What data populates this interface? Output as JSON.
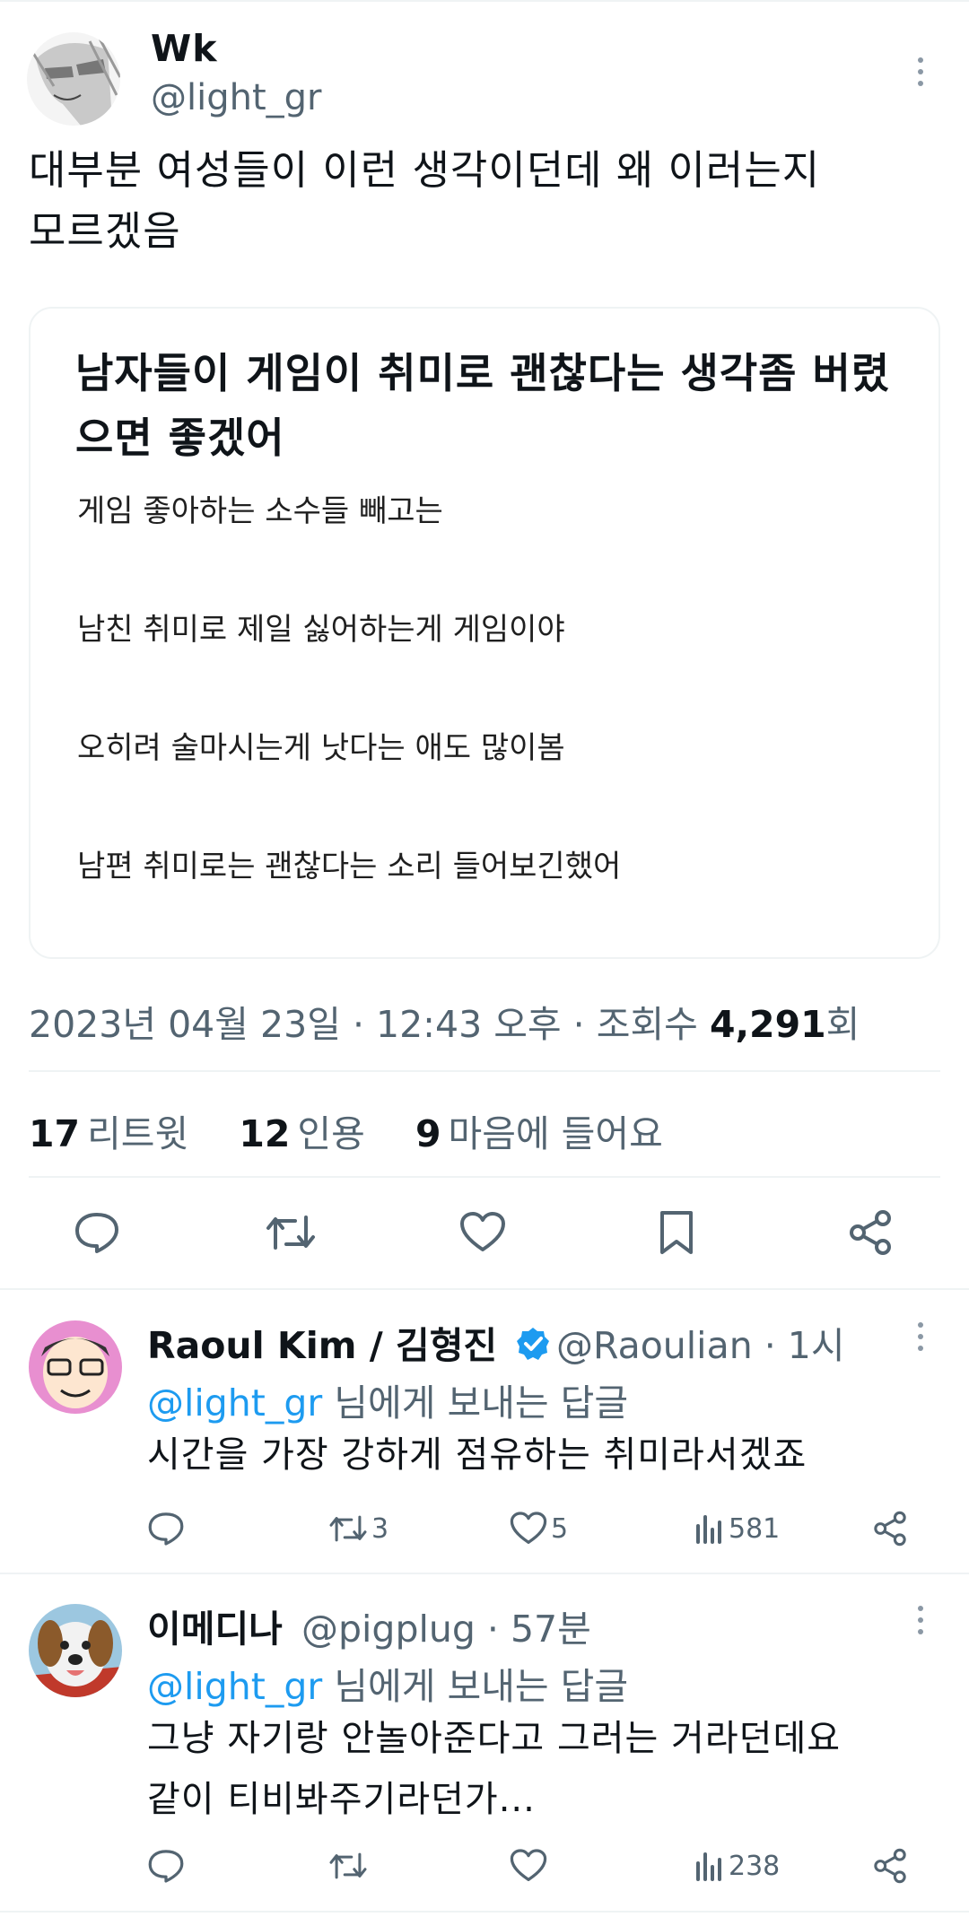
{
  "tweet": {
    "author_name": "Wk",
    "author_handle": "@light_gr",
    "text_line1": "대부분 여성들이 이런 생각이던데 왜 이러는지",
    "text_line2": "모르겠음",
    "card": {
      "title": "남자들이 게임이 취미로 괜찮다는 생각좀 버렸으면 좋겠어",
      "lines": [
        "게임 좋아하는 소수들 빼고는",
        "남친 취미로 제일 싫어하는게 게임이야",
        "오히려 술마시는게 낫다는 애도 많이봄",
        "남편 취미로는  괜찮다는 소리 들어보긴했어"
      ]
    },
    "timestamp": "2023년 04월 23일 · 12:43 오후 · 조회수 ",
    "views": "4,291",
    "views_suffix": "회",
    "stats": {
      "retweets": "17",
      "retweets_label": "리트윗",
      "quotes": "12",
      "quotes_label": "인용",
      "likes": "9",
      "likes_label": "마음에 들어요"
    }
  },
  "replies": [
    {
      "name": "Raoul Kim / 김형진",
      "verified": true,
      "handle_time": "@Raoulian · 1시",
      "reply_to_mention": "@light_gr",
      "reply_to_suffix": " 님에게 보내는 답글",
      "text_line1": "시간을 가장 강하게 점유하는 취미라서겠죠",
      "text_line2": "",
      "retweets": "3",
      "likes": "5",
      "views": "581"
    },
    {
      "name": "이메디나",
      "verified": false,
      "handle_time": "@pigplug · 57분",
      "reply_to_mention": "@light_gr",
      "reply_to_suffix": " 님에게 보내는 답글",
      "text_line1": "그냥 자기랑 안놀아준다고 그러는 거라던데요",
      "text_line2": "같이 티비봐주기라던가...",
      "retweets": "",
      "likes": "",
      "views": "238"
    }
  ],
  "icons": {
    "reply": "reply-icon",
    "retweet": "retweet-icon",
    "like": "heart-icon",
    "bookmark": "bookmark-icon",
    "share": "share-icon",
    "views": "views-icon",
    "more": "more-icon",
    "verified": "verified-badge-icon"
  },
  "colors": {
    "text": "#0f1419",
    "secondary": "#536471",
    "accent": "#1d9bf0",
    "divider": "#eff3f4"
  }
}
